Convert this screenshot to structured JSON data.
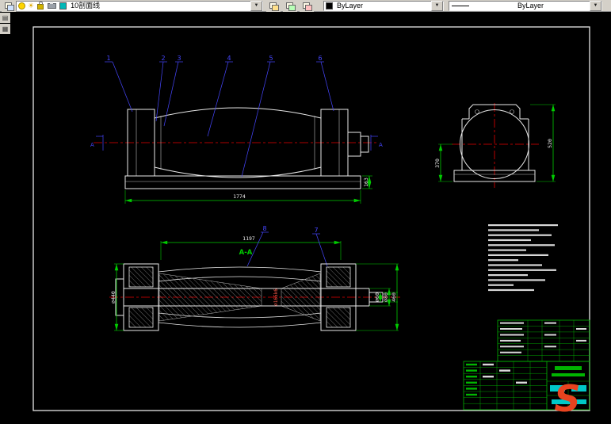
{
  "toolbar": {
    "layer_value": "10剖面线",
    "color_value": "ByLayer",
    "linetype_value": "ByLayer"
  },
  "canvas": {
    "callouts_top": [
      "1",
      "2",
      "3",
      "4",
      "5",
      "6"
    ],
    "callout_8": "8",
    "callout_7": "7",
    "section_label": "A-A",
    "cut_label_left": "A",
    "cut_label_right": "A",
    "dims": {
      "overall_length": "1774",
      "base_height": "163",
      "end_view_width": "370",
      "end_view_height": "520",
      "section_length": "1197",
      "hub_dia": "∅440",
      "shaft_dia": "∅165k6",
      "stub_dia_1": "∅60",
      "stub_dia_2": "∅80",
      "shaft_ext_len": "460"
    }
  },
  "watermark": {
    "letter": "S"
  }
}
